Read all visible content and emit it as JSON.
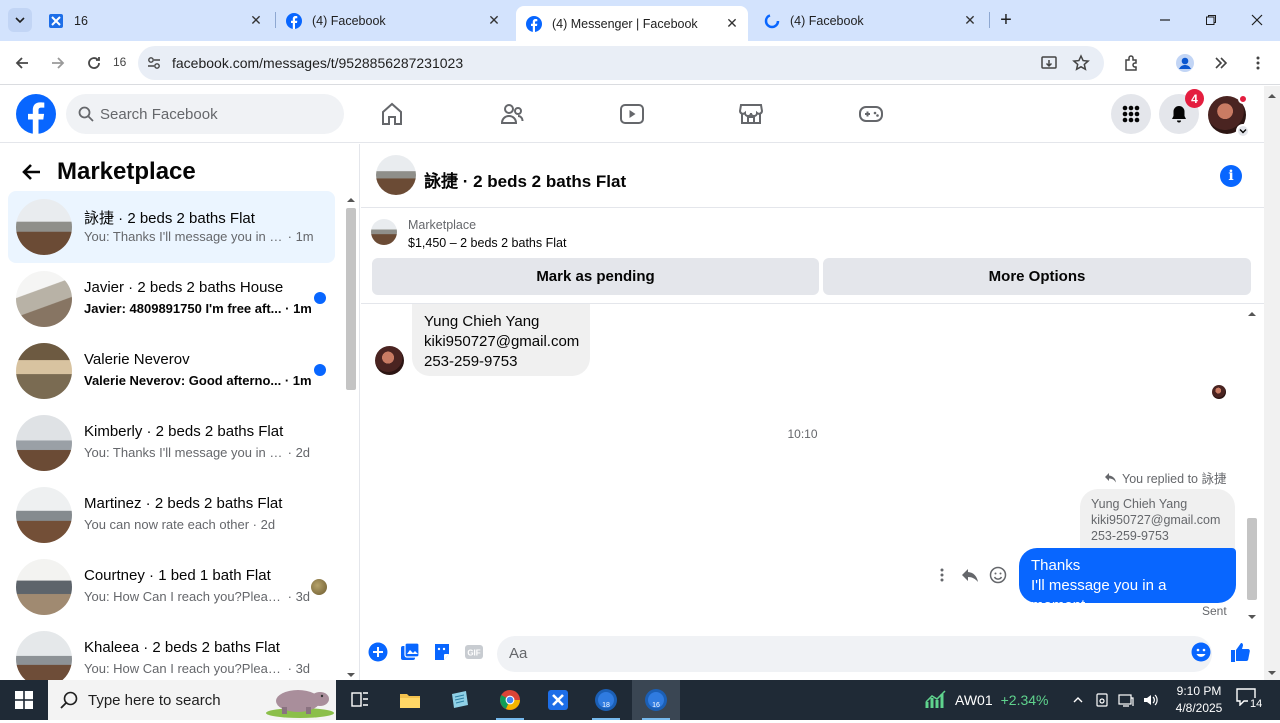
{
  "browser": {
    "tabs": [
      {
        "label": "16",
        "active": false
      },
      {
        "label": "(4) Facebook",
        "active": false
      },
      {
        "label": "(4) Messenger | Facebook",
        "active": true
      },
      {
        "label": "(4) Facebook",
        "active": false
      }
    ],
    "url": "facebook.com/messages/t/9528856287231023",
    "reload_count": "16"
  },
  "facebook": {
    "search_placeholder": "Search Facebook",
    "notification_count": "4"
  },
  "sidebar": {
    "title": "Marketplace",
    "conversations": [
      {
        "name": "詠捷 · 2 beds 2 baths Flat",
        "preview": "You: Thanks I'll message you in a ...",
        "time": "· 1m",
        "unread": false,
        "active": true
      },
      {
        "name": "Javier · 2 beds 2 baths House",
        "preview": "Javier: 4809891750 I'm free aft...",
        "time": "· 1m",
        "unread": true,
        "active": false
      },
      {
        "name": "Valerie Neverov",
        "preview": "Valerie Neverov: Good afterno...",
        "time": "· 1m",
        "unread": true,
        "active": false
      },
      {
        "name": "Kimberly · 2 beds 2 baths Flat",
        "preview": "You: Thanks I'll message you in a ...",
        "time": "· 2d",
        "unread": false,
        "active": false
      },
      {
        "name": "Martinez · 2 beds 2 baths Flat",
        "preview": "You can now rate each other",
        "time": "· 2d",
        "unread": false,
        "active": false
      },
      {
        "name": "Courtney · 1 bed 1 bath Flat",
        "preview": "You: How Can I reach you?Pleas...",
        "time": "· 3d",
        "unread": false,
        "active": false
      },
      {
        "name": "Khaleea · 2 beds 2 baths Flat",
        "preview": "You: How Can I reach you?Please s...",
        "time": "· 3d",
        "unread": false,
        "active": false
      }
    ]
  },
  "chat": {
    "title": "詠捷 · 2 beds 2 baths Flat",
    "listing_category": "Marketplace",
    "listing_price": "$1,450 – 2 beds 2 baths Flat",
    "mark_pending_label": "Mark as pending",
    "more_options_label": "More Options",
    "incoming_lines": [
      "Yung Chieh Yang",
      "kiki950727@gmail.com",
      "253-259-9753"
    ],
    "timestamp": "10:10",
    "replied_label": "You replied to 詠捷",
    "quote_lines": [
      "Yung Chieh Yang",
      "kiki950727@gmail.com",
      "253-259-9753"
    ],
    "outgoing_lines": [
      "Thanks",
      "I'll message you in a moment"
    ],
    "sent_status": "Sent",
    "composer_placeholder": "Aa"
  },
  "taskbar": {
    "search_placeholder": "Type here to search",
    "stock_symbol": "AW01",
    "stock_change": "+2.34%",
    "time": "9:10 PM",
    "date": "4/8/2025",
    "notification_count": "14",
    "app_badges": {
      "app1": "18",
      "app2": "16"
    }
  },
  "colors": {
    "fb_blue": "#0866ff",
    "unread_dot": "#0866ff",
    "badge_red": "#e41e3f"
  }
}
